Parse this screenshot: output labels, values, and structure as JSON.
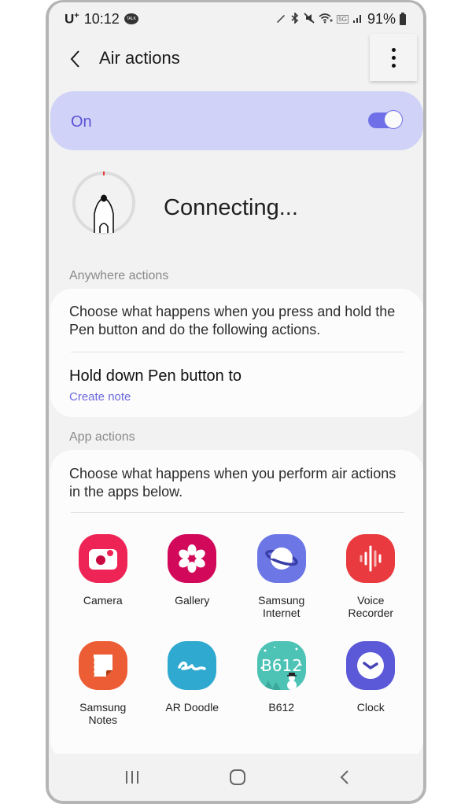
{
  "status_bar": {
    "carrier": "U",
    "carrier_sup": "+",
    "time": "10:12",
    "notification_icon": "kakaotalk-icon",
    "notification_text": "TALK",
    "icons": [
      "pen-icon",
      "bluetooth-icon",
      "mute-icon",
      "wifi-icon",
      "5g-icon",
      "signal-icon"
    ],
    "network": "5G",
    "battery": "91%"
  },
  "app_bar": {
    "back_icon": "chevron-left-icon",
    "title": "Air actions",
    "more_icon": "more-vertical-icon"
  },
  "master_switch": {
    "label": "On",
    "state": true,
    "accent_color": "#6f70e8",
    "background_color": "#d0d3f7"
  },
  "pen_status": {
    "icon": "s-pen-icon",
    "text": "Connecting..."
  },
  "anywhere_actions": {
    "section_title": "Anywhere actions",
    "description": "Choose what happens when you press and hold the Pen button and do the following actions.",
    "hold_title": "Hold down Pen button to",
    "hold_value": "Create note"
  },
  "app_actions": {
    "section_title": "App actions",
    "description": "Choose what happens when you perform air actions in the apps below.",
    "apps": [
      {
        "label": "Camera",
        "icon": "camera-icon",
        "color": "#ef2456"
      },
      {
        "label": "Gallery",
        "icon": "gallery-flower-icon",
        "color": "#d2095a"
      },
      {
        "label": "Samsung\nInternet",
        "icon": "planet-icon",
        "color": "#6c77e5"
      },
      {
        "label": "Voice\nRecorder",
        "icon": "waveform-icon",
        "color": "#e93b3f"
      },
      {
        "label": "Samsung\nNotes",
        "icon": "notes-icon",
        "color": "#ed5d35"
      },
      {
        "label": "AR Doodle",
        "icon": "doodle-squiggle-icon",
        "color": "#2fa9cf"
      },
      {
        "label": "B612",
        "icon": "b612-snowman-icon",
        "color": "#4dc3b5"
      },
      {
        "label": "Clock",
        "icon": "clock-icon",
        "color": "#5c59d9"
      }
    ]
  },
  "nav_bar": {
    "recents_icon": "recents-icon",
    "home_icon": "home-icon",
    "back_icon": "back-icon"
  }
}
